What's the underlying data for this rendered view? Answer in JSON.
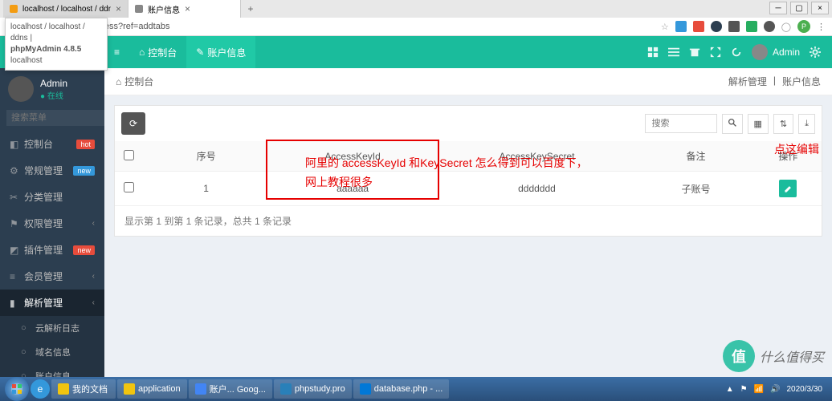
{
  "browser": {
    "tabs": [
      {
        "title": "localhost / localhost / ddns | p",
        "favicon": "#f39c12"
      },
      {
        "title": "账户信息",
        "favicon": "#888"
      }
    ],
    "tooltip": {
      "line1": "localhost / localhost / ddns |",
      "line2": "phpMyAdmin 4.8.5",
      "line3": "localhost"
    },
    "url": "n.php/ddns/access?ref=addtabs",
    "avatar_letter": "P"
  },
  "header": {
    "tabs": [
      {
        "icon": "⌂",
        "label": "控制台"
      },
      {
        "icon": "✎",
        "label": "账户信息"
      }
    ],
    "admin_label": "Admin"
  },
  "sidebar": {
    "user": {
      "name": "Admin",
      "status": "● 在线"
    },
    "search_placeholder": "搜索菜单",
    "items": [
      {
        "icon": "◧",
        "label": "控制台",
        "badge": "hot",
        "badge_cls": "b-hot"
      },
      {
        "icon": "⚙",
        "label": "常规管理",
        "badge": "new",
        "badge_cls": "b-new",
        "arrow": true
      },
      {
        "icon": "✂",
        "label": "分类管理"
      },
      {
        "icon": "⚑",
        "label": "权限管理",
        "arrow": true
      },
      {
        "icon": "◩",
        "label": "插件管理",
        "badge": "new",
        "badge_cls": "b-new2"
      },
      {
        "icon": "≡",
        "label": "会员管理",
        "arrow": true
      },
      {
        "icon": "▮",
        "label": "解析管理",
        "arrow": true,
        "active": true
      }
    ],
    "subitems": [
      {
        "icon": "○",
        "label": "云解析日志"
      },
      {
        "icon": "○",
        "label": "域名信息"
      },
      {
        "icon": "○",
        "label": "账户信息"
      }
    ]
  },
  "crumb": {
    "icon": "⌂",
    "label": "控制台",
    "right1": "解析管理",
    "right2": "账户信息"
  },
  "toolbar": {
    "refresh_icon": "⟳",
    "search_placeholder": "搜索",
    "cols_icon": "▦",
    "sort_icon": "⇅",
    "export_icon": "⤓"
  },
  "table": {
    "headers": {
      "check": "",
      "id": "序号",
      "key": "AccessKeyId",
      "secret": "AccessKeySecret",
      "remark": "备注",
      "op": "操作"
    },
    "rows": [
      {
        "id": "1",
        "key": "aaaaaa",
        "secret": "ddddddd",
        "remark": "子账号"
      }
    ],
    "pager": "显示第 1 到第 1 条记录，总共 1 条记录"
  },
  "annotations": {
    "hint": "阿里的 accessKeyId  和KeySecret  怎么得到可以百度下，网上教程很多",
    "edit_hint": "点这编辑"
  },
  "taskbar": {
    "apps": [
      {
        "color": "#f1c40f",
        "label": "我的文档"
      },
      {
        "color": "#f1c40f",
        "label": "application"
      },
      {
        "color": "#4285f4",
        "label": "账户... Goog..."
      },
      {
        "color": "#2980b9",
        "label": "phpstudy.pro"
      },
      {
        "color": "#0078d7",
        "label": "database.php - ..."
      }
    ],
    "clock": {
      "time": "",
      "date": "2020/3/30"
    }
  },
  "watermark": {
    "text": "什么值得买",
    "letter": "值"
  }
}
